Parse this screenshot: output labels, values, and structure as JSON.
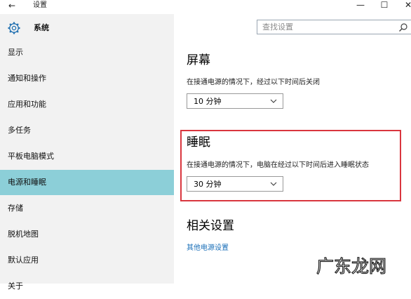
{
  "titlebar": {
    "back": "←",
    "title": "设置",
    "minimize": "—",
    "maximize": "☐",
    "close": "✕"
  },
  "sidebar": {
    "app_name": "系统",
    "items": [
      {
        "label": "显示"
      },
      {
        "label": "通知和操作"
      },
      {
        "label": "应用和功能"
      },
      {
        "label": "多任务"
      },
      {
        "label": "平板电脑模式"
      },
      {
        "label": "电源和睡眠",
        "active": true
      },
      {
        "label": "存储"
      },
      {
        "label": "脱机地图"
      },
      {
        "label": "默认应用"
      },
      {
        "label": "关于"
      }
    ]
  },
  "search": {
    "placeholder": "查找设置"
  },
  "screen": {
    "title": "屏幕",
    "desc": "在接通电源的情况下，经过以下时间后关闭",
    "value": "10 分钟"
  },
  "sleep": {
    "title": "睡眠",
    "desc": "在接通电源的情况下，电脑在经过以下时间后进入睡眠状态",
    "value": "30 分钟"
  },
  "related": {
    "title": "相关设置",
    "link": "其他电源设置"
  },
  "watermark": {
    "text": "广东龙网"
  },
  "colors": {
    "active_nav": "#8ccfd8",
    "highlight_border": "#d9363e",
    "link": "#1a6fb8"
  }
}
